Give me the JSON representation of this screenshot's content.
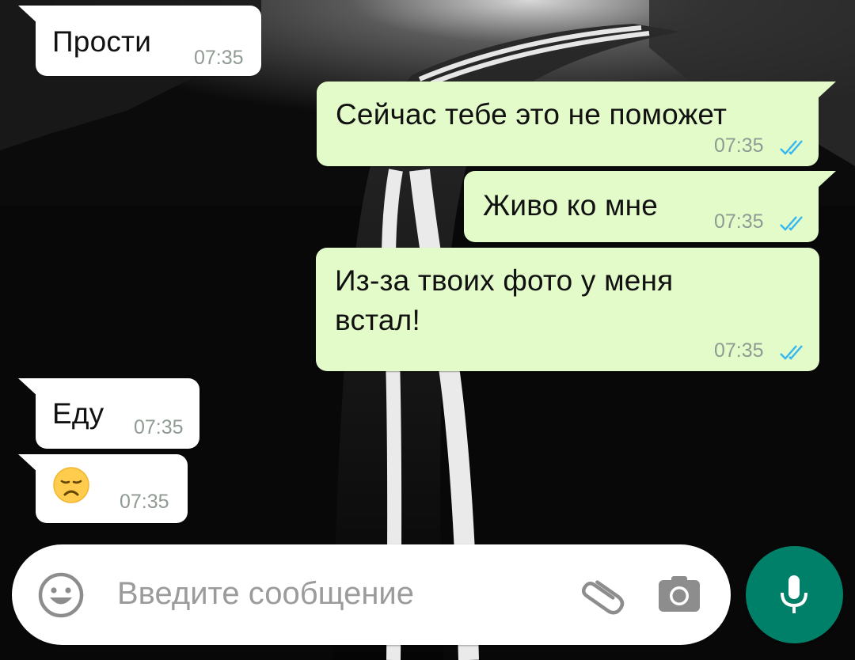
{
  "messages": [
    {
      "direction": "incoming",
      "text": "Прости",
      "time": "07:35"
    },
    {
      "direction": "outgoing",
      "text": "Сейчас тебе это не поможет",
      "time": "07:35",
      "status": "read"
    },
    {
      "direction": "outgoing",
      "text": "Живо ко мне",
      "time": "07:35",
      "status": "read"
    },
    {
      "direction": "outgoing",
      "text_line1": "Из-за твоих фото у меня",
      "text_line2": "встал!",
      "time": "07:35",
      "status": "read"
    },
    {
      "direction": "incoming",
      "text": "Еду",
      "time": "07:35"
    },
    {
      "direction": "incoming",
      "emoji": "😞",
      "emoji_name": "disappointed-face",
      "time": "07:35"
    }
  ],
  "composer": {
    "placeholder": "Введите сообщение",
    "icons": [
      "emoji-icon",
      "paperclip-icon",
      "camera-icon",
      "microphone-icon"
    ]
  },
  "colors": {
    "incoming_bubble": "#ffffff",
    "outgoing_bubble": "#e2fbc9",
    "read_ticks": "#34b7f1",
    "mic_button": "#008069",
    "timestamp": "#8e9a92"
  }
}
